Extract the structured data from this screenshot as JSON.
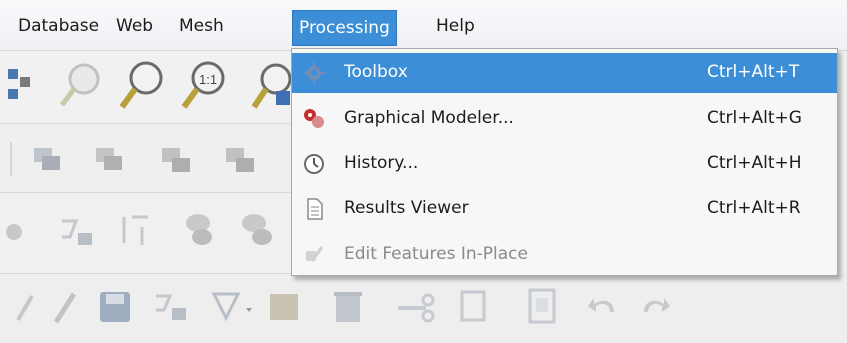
{
  "menubar": {
    "items": [
      {
        "id": "database",
        "label": "Database"
      },
      {
        "id": "web",
        "label": "Web"
      },
      {
        "id": "mesh",
        "label": "Mesh"
      },
      {
        "id": "processing",
        "label": "Processing"
      },
      {
        "id": "help",
        "label": "Help"
      }
    ]
  },
  "processing_menu": {
    "items": [
      {
        "label": "Toolbox",
        "shortcut": "Ctrl+Alt+T",
        "icon": "gear-icon",
        "state": "highlighted"
      },
      {
        "label": "Graphical Modeler...",
        "shortcut": "Ctrl+Alt+G",
        "icon": "modeler-icon",
        "state": "normal"
      },
      {
        "label": "History...",
        "shortcut": "Ctrl+Alt+H",
        "icon": "clock-icon",
        "state": "normal"
      },
      {
        "label": "Results Viewer",
        "shortcut": "Ctrl+Alt+R",
        "icon": "document-icon",
        "state": "normal"
      },
      {
        "label": "Edit Features In-Place",
        "shortcut": "",
        "icon": "edit-in-place-icon",
        "state": "disabled"
      }
    ]
  },
  "colors": {
    "highlight": "#3c8fd6",
    "menu_background": "#f7f7f7",
    "disabled_text": "#8a8a8a"
  }
}
